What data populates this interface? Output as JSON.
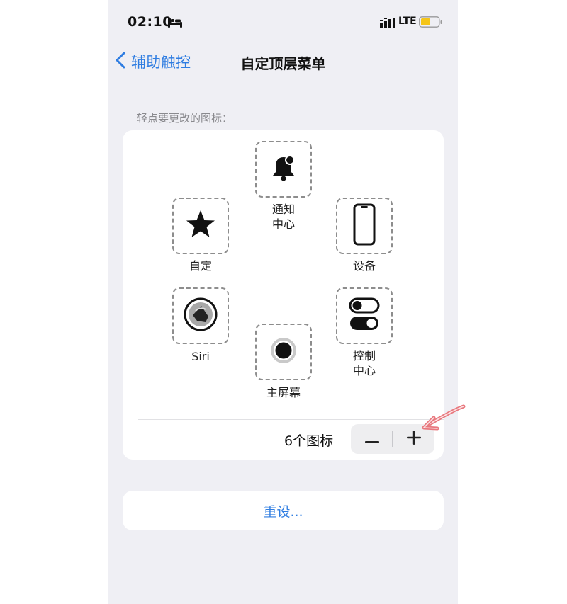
{
  "status_bar": {
    "time": "02:10",
    "network": "LTE"
  },
  "nav": {
    "back_label": "辅助触控",
    "title": "自定顶层菜单"
  },
  "section_label": "轻点要更改的图标：",
  "icons": [
    {
      "label": "通知\n中心",
      "icon": "bell-icon"
    },
    {
      "label": "自定",
      "icon": "star-icon"
    },
    {
      "label": "设备",
      "icon": "phone-device-icon"
    },
    {
      "label": "Siri",
      "icon": "siri-icon"
    },
    {
      "label": "控制\n中心",
      "icon": "toggle-switches-icon"
    },
    {
      "label": "主屏幕",
      "icon": "home-button-icon"
    }
  ],
  "count_label": "6个图标",
  "stepper": {
    "minus": "−",
    "plus": "+"
  },
  "reset_label": "重设...",
  "colors": {
    "accent": "#2f7de1",
    "annotation": "#e8787e",
    "battery": "#f5c518"
  }
}
